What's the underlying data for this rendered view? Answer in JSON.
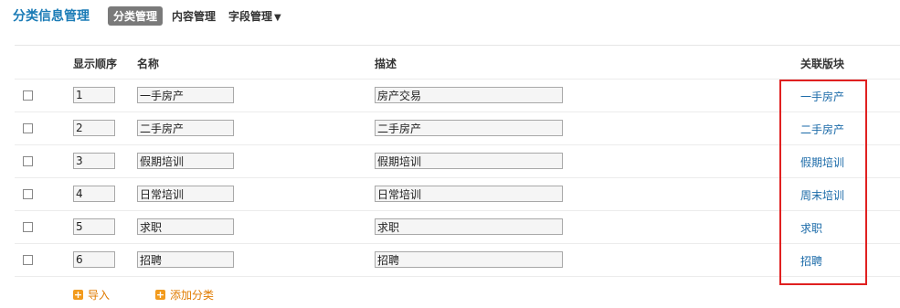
{
  "header": {
    "title": "分类信息管理",
    "tabs": [
      {
        "label": "分类管理",
        "active": true
      },
      {
        "label": "内容管理",
        "active": false
      },
      {
        "label": "字段管理",
        "active": false,
        "dropdown": true
      }
    ]
  },
  "columns": {
    "order": "显示顺序",
    "name": "名称",
    "desc": "描述",
    "linked": "关联版块"
  },
  "rows": [
    {
      "order": "1",
      "name": "一手房产",
      "desc": "房产交易",
      "linked": "一手房产"
    },
    {
      "order": "2",
      "name": "二手房产",
      "desc": "二手房产",
      "linked": "二手房产"
    },
    {
      "order": "3",
      "name": "假期培训",
      "desc": "假期培训",
      "linked": "假期培训"
    },
    {
      "order": "4",
      "name": "日常培训",
      "desc": "日常培训",
      "linked": "周末培训"
    },
    {
      "order": "5",
      "name": "求职",
      "desc": "求职",
      "linked": "求职"
    },
    {
      "order": "6",
      "name": "招聘",
      "desc": "招聘",
      "linked": "招聘"
    }
  ],
  "actions": {
    "import_label": "导入",
    "add_label": "添加分类"
  },
  "colors": {
    "accent": "#1a7bb6",
    "link": "#1a6aa8",
    "action": "#e07b00",
    "highlight": "#e02020",
    "active_tab_bg": "#7a7a7a"
  }
}
